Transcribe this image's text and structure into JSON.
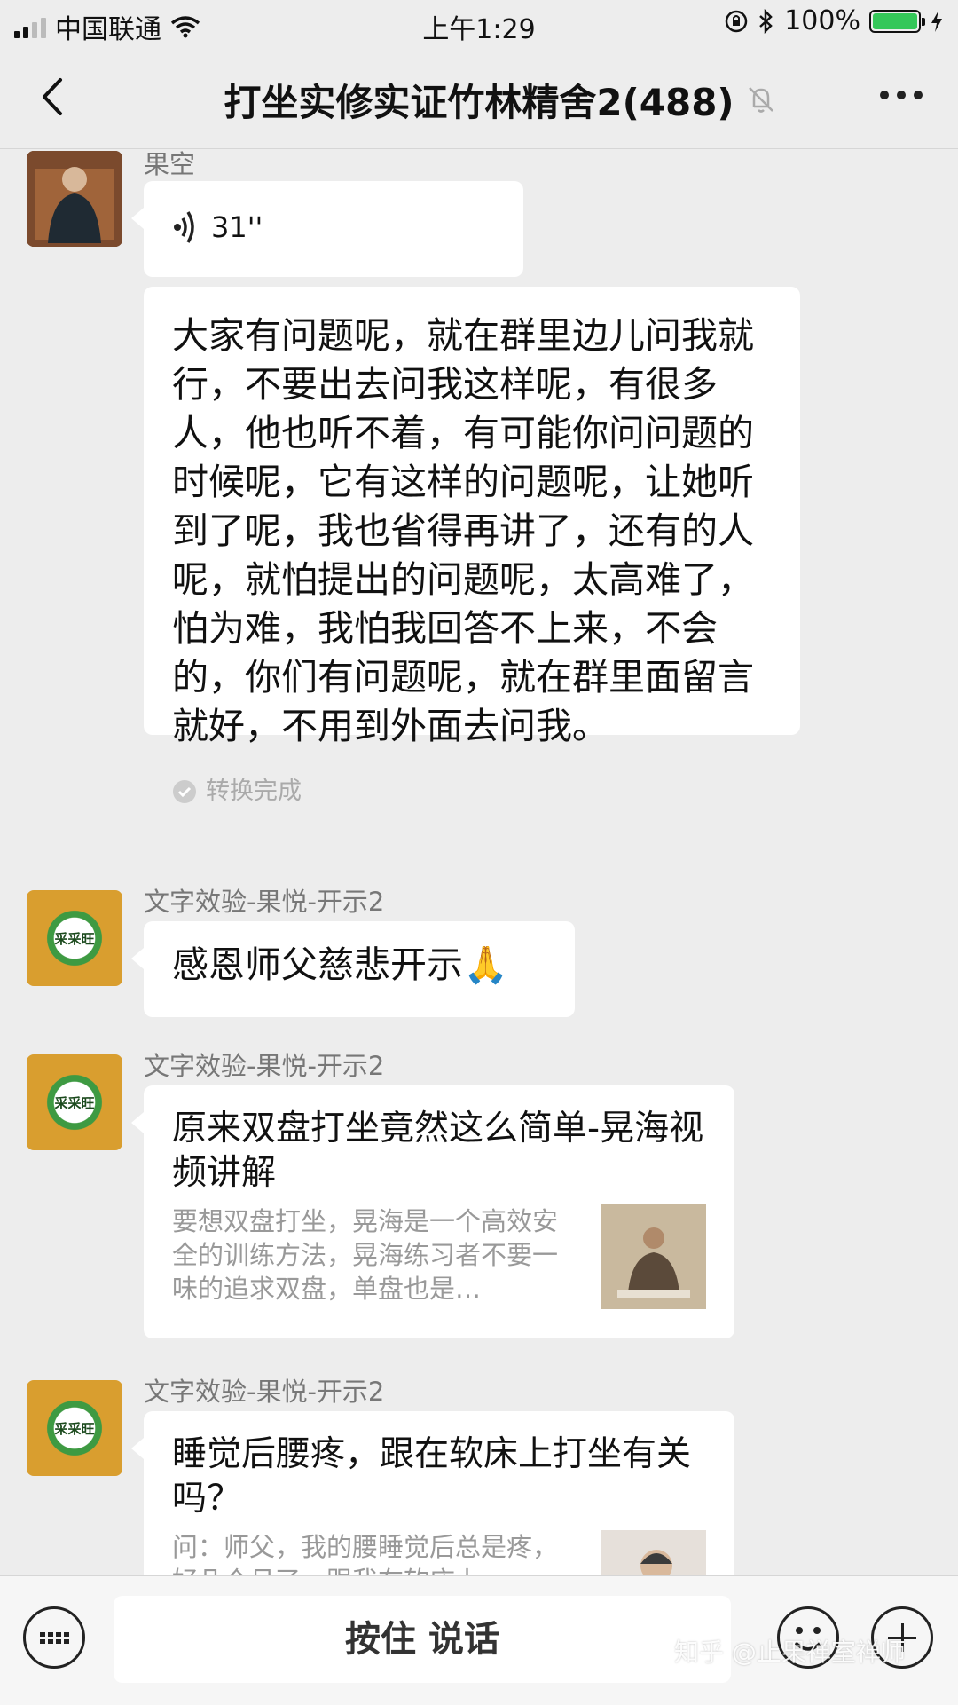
{
  "status_bar": {
    "carrier": "中国联通",
    "time": "上午1:29",
    "battery": "100%",
    "battery_level": 1.0
  },
  "nav": {
    "title": "打坐实修实证竹林精舍2(488)",
    "back_icon": "chevron-left-icon",
    "mute_icon": "bell-muted-icon",
    "more_icon": "more-dots-icon"
  },
  "messages": [
    {
      "sender": "果空",
      "voice": {
        "duration": "31''"
      },
      "transcript": "大家有问题呢，就在群里边儿问我就行，不要出去问我这样呢，有很多人，他也听不着，有可能你问问题的时候呢，它有这样的问题呢，让她听到了呢，我也省得再讲了，还有的人呢，就怕提出的问题呢，太高难了，怕为难，我怕我回答不上来，不会的，你们有问题呢，就在群里面留言就好，不用到外面去问我。",
      "transcript_status": "转换完成"
    },
    {
      "sender": "文字效验-果悦-开示2",
      "text": "感恩师父慈悲开示🙏",
      "avatar_text": "采采旺"
    },
    {
      "sender": "文字效验-果悦-开示2",
      "avatar_text": "采采旺",
      "card": {
        "title": "原来双盘打坐竟然这么简单-晃海视频讲解",
        "desc": "要想双盘打坐，晃海是一个高效安全的训练方法，晃海练习者不要一味的追求双盘，单盘也是…"
      }
    },
    {
      "sender": "文字效验-果悦-开示2",
      "avatar_text": "采采旺",
      "card": {
        "title": "睡觉后腰疼，跟在软床上打坐有关吗？",
        "desc": "问：师父，我的腰睡觉后总是疼，好几个月了，跟我在软床上…"
      }
    }
  ],
  "input_bar": {
    "hold_to_talk": "按住 说话",
    "keyboard_icon": "keyboard-icon",
    "emoji_icon": "emoji-icon",
    "plus_icon": "plus-icon"
  },
  "watermark": "知乎 @止果禅室禅师"
}
